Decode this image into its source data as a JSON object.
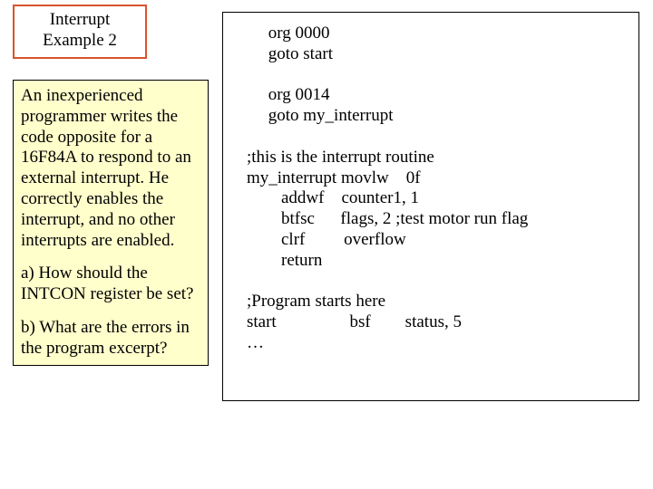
{
  "title": {
    "line1": "Interrupt",
    "line2": "Example 2"
  },
  "explain": {
    "para1": "An inexperienced programmer writes the code opposite for a 16F84A to respond to an external interrupt. He correctly enables the interrupt, and no other interrupts are enabled.",
    "q1": "a) How should the INTCON register be set?",
    "q2": "b) What are the errors in the program excerpt?"
  },
  "code": {
    "l01": "     org 0000",
    "l02": "     goto start",
    "l03": "",
    "l04": "     org 0014",
    "l05": "     goto my_interrupt",
    "l06": "",
    "l07": ";this is the interrupt routine",
    "l08": "my_interrupt movlw    0f",
    "l09": "        addwf    counter1, 1",
    "l10": "        btfsc      flags, 2 ;test motor run flag",
    "l11": "        clrf         overflow",
    "l12": "        return",
    "l13": "",
    "l14": ";Program starts here",
    "l15": "start                 bsf        status, 5",
    "l16": "…"
  }
}
